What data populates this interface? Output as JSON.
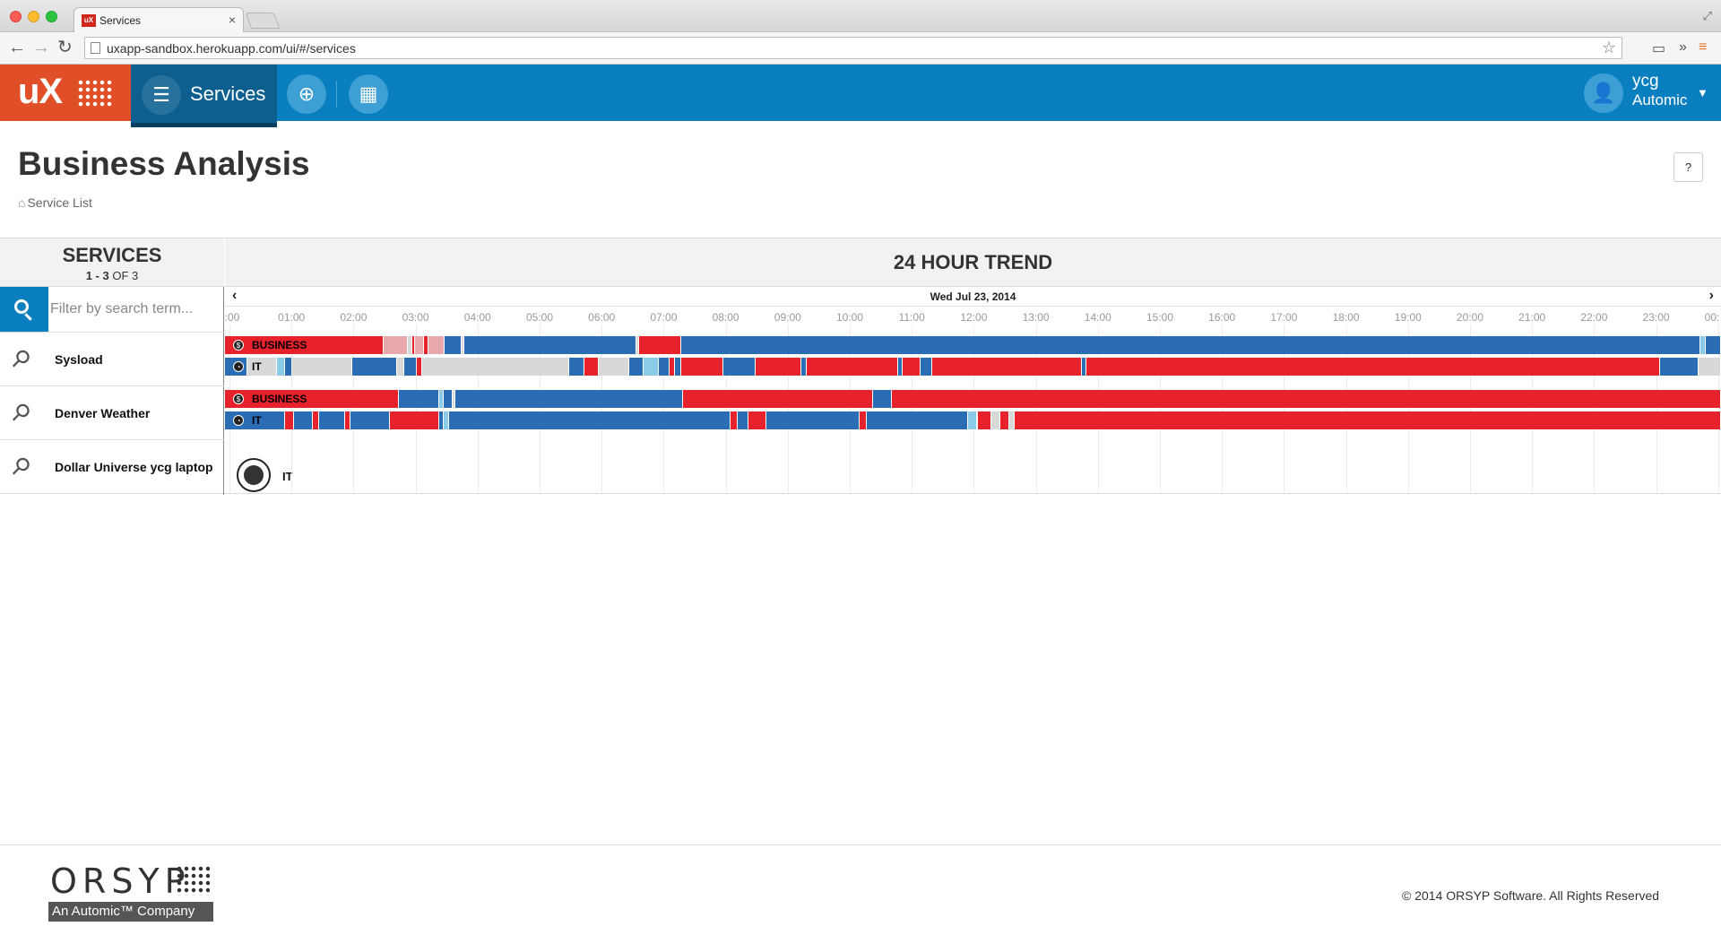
{
  "browser": {
    "tab_title": "Services",
    "tab_favicon": "uX",
    "url": "uxapp-sandbox.herokuapp.com/ui/#/services",
    "icons": [
      "back-icon",
      "forward-icon",
      "reload-icon",
      "page-icon",
      "star-icon",
      "cast-icon",
      "extensions-icon",
      "menu-icon"
    ]
  },
  "header": {
    "logo": "uX",
    "nav_active_label": "Services",
    "nav_icons": [
      "list-icon",
      "add-service-icon",
      "calendar-icon"
    ],
    "user": {
      "name": "ycg",
      "org": "Automic"
    }
  },
  "page": {
    "title": "Business Analysis",
    "breadcrumb": "Service List",
    "help": "?"
  },
  "services_panel": {
    "title": "SERVICES",
    "count_range": "1 - 3",
    "count_total": "OF 3",
    "search_placeholder": "Filter by search term...",
    "items": [
      {
        "name": "Sysload"
      },
      {
        "name": "Denver Weather"
      },
      {
        "name": "Dollar Universe ycg laptop"
      }
    ]
  },
  "trend": {
    "title": "24 HOUR TREND",
    "date": "Wed Jul 23, 2014",
    "hours": [
      ":00",
      "01:00",
      "02:00",
      "03:00",
      "04:00",
      "05:00",
      "06:00",
      "07:00",
      "08:00",
      "09:00",
      "10:00",
      "11:00",
      "12:00",
      "13:00",
      "14:00",
      "15:00",
      "16:00",
      "17:00",
      "18:00",
      "19:00",
      "20:00",
      "21:00",
      "22:00",
      "23:00",
      "00:"
    ],
    "colors": {
      "red": "#e8222a",
      "blue": "#2a6db5",
      "lightblue": "#8ccbe8",
      "gray": "#d8d8d8",
      "pink": "#e8a9ac"
    },
    "bars": [
      {
        "service": "Sysload",
        "label": "BUSINESS",
        "icon": "dollar-icon",
        "segments": [
          [
            "red",
            0,
            10.6
          ],
          [
            "pink",
            10.6,
            12.2
          ],
          [
            "gray",
            12.2,
            12.5
          ],
          [
            "red",
            12.5,
            12.7
          ],
          [
            "pink",
            12.7,
            13.3
          ],
          [
            "red",
            13.3,
            13.6
          ],
          [
            "pink",
            13.6,
            14.7
          ],
          [
            "blue",
            14.7,
            15.8
          ],
          [
            "gray",
            15.8,
            16.0
          ],
          [
            "blue",
            16.0,
            27.5
          ],
          [
            "gray",
            27.5,
            27.7
          ],
          [
            "red",
            27.7,
            30.5
          ],
          [
            "blue",
            30.5,
            98.6
          ],
          [
            "lightblue",
            98.6,
            99.0
          ],
          [
            "blue",
            99.0,
            100
          ]
        ]
      },
      {
        "service": "Sysload",
        "label": "IT",
        "icon": "gauge-icon",
        "segments": [
          [
            "blue",
            0,
            1.5
          ],
          [
            "gray",
            1.5,
            3.5
          ],
          [
            "lightblue",
            3.5,
            4.0
          ],
          [
            "blue",
            4.0,
            4.5
          ],
          [
            "gray",
            4.5,
            8.5
          ],
          [
            "blue",
            8.5,
            11.5
          ],
          [
            "gray",
            11.5,
            12.0
          ],
          [
            "blue",
            12.0,
            12.8
          ],
          [
            "red",
            12.8,
            13.2
          ],
          [
            "gray",
            13.2,
            23.0
          ],
          [
            "blue",
            23.0,
            24.0
          ],
          [
            "red",
            24.0,
            25.0
          ],
          [
            "gray",
            25.0,
            27.0
          ],
          [
            "blue",
            27.0,
            28.0
          ],
          [
            "lightblue",
            28.0,
            29.0
          ],
          [
            "blue",
            29.0,
            29.7
          ],
          [
            "red",
            29.7,
            30.1
          ],
          [
            "blue",
            30.1,
            30.5
          ],
          [
            "red",
            30.5,
            33.3
          ],
          [
            "blue",
            33.3,
            35.5
          ],
          [
            "red",
            35.5,
            38.5
          ],
          [
            "blue",
            38.5,
            38.9
          ],
          [
            "red",
            38.9,
            45.0
          ],
          [
            "blue",
            45.0,
            45.3
          ],
          [
            "red",
            45.3,
            46.5
          ],
          [
            "blue",
            46.5,
            47.3
          ],
          [
            "red",
            47.3,
            57.3
          ],
          [
            "blue",
            57.3,
            57.6
          ],
          [
            "red",
            57.6,
            95.9
          ],
          [
            "blue",
            95.9,
            98.5
          ],
          [
            "gray",
            98.5,
            100
          ]
        ]
      },
      {
        "service": "Denver Weather",
        "label": "BUSINESS",
        "icon": "dollar-icon",
        "segments": [
          [
            "red",
            0,
            11.6
          ],
          [
            "blue",
            11.6,
            14.3
          ],
          [
            "lightblue",
            14.3,
            14.6
          ],
          [
            "blue",
            14.6,
            15.2
          ],
          [
            "gray",
            15.2,
            15.4
          ],
          [
            "blue",
            15.4,
            30.6
          ],
          [
            "red",
            30.6,
            43.3
          ],
          [
            "blue",
            43.3,
            44.6
          ],
          [
            "red",
            44.6,
            100
          ]
        ]
      },
      {
        "service": "Denver Weather",
        "label": "IT",
        "icon": "gauge-icon",
        "segments": [
          [
            "blue",
            0,
            4.0
          ],
          [
            "red",
            4.0,
            4.6
          ],
          [
            "blue",
            4.6,
            5.9
          ],
          [
            "red",
            5.9,
            6.3
          ],
          [
            "blue",
            6.3,
            8.0
          ],
          [
            "red",
            8.0,
            8.4
          ],
          [
            "blue",
            8.4,
            11.0
          ],
          [
            "red",
            11.0,
            14.3
          ],
          [
            "blue",
            14.3,
            14.6
          ],
          [
            "lightblue",
            14.6,
            15.0
          ],
          [
            "blue",
            15.0,
            33.8
          ],
          [
            "red",
            33.8,
            34.3
          ],
          [
            "blue",
            34.3,
            35.0
          ],
          [
            "red",
            35.0,
            36.2
          ],
          [
            "blue",
            36.2,
            42.4
          ],
          [
            "red",
            42.4,
            42.9
          ],
          [
            "blue",
            42.9,
            49.7
          ],
          [
            "lightblue",
            49.7,
            50.3
          ],
          [
            "red",
            50.3,
            51.2
          ],
          [
            "gray",
            51.2,
            51.8
          ],
          [
            "red",
            51.8,
            52.4
          ],
          [
            "gray",
            52.4,
            52.8
          ],
          [
            "red",
            52.8,
            100
          ]
        ]
      }
    ],
    "unavailable_label": "IT"
  },
  "footer": {
    "company": "ORSYP",
    "tagline": "An Automic™ Company",
    "copyright": "© 2014 ORSYP Software. All Rights Reserved"
  }
}
